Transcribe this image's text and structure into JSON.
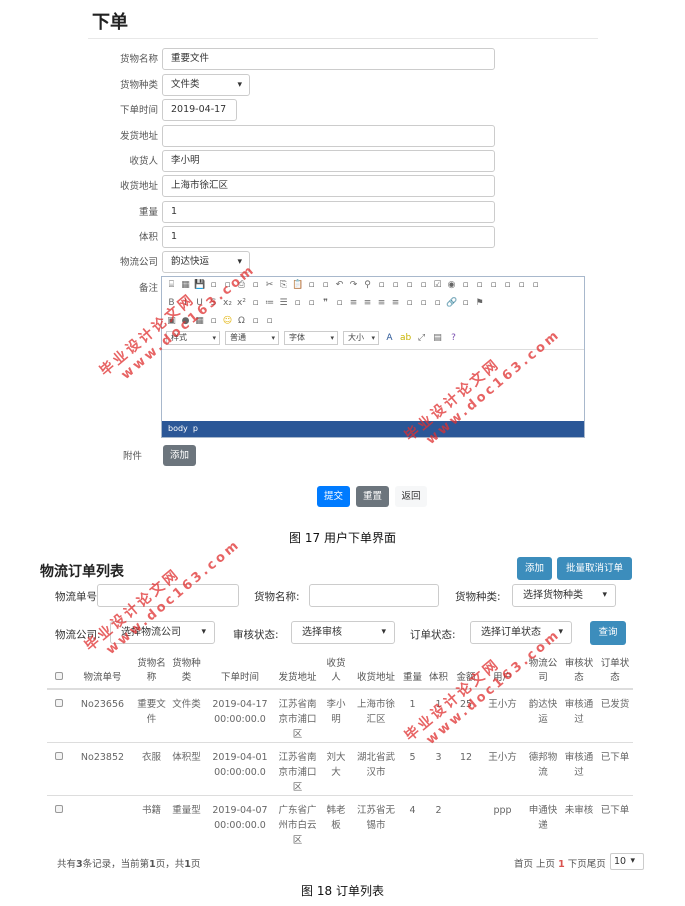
{
  "order_form": {
    "title": "下单",
    "fields": [
      {
        "label": "货物名称",
        "value": "重要文件",
        "type": "text"
      },
      {
        "label": "货物种类",
        "value": "文件类",
        "type": "select"
      },
      {
        "label": "下单时间",
        "value": "2019-04-17",
        "type": "date"
      },
      {
        "label": "发货地址",
        "value": "",
        "type": "text"
      },
      {
        "label": "收货人",
        "value": "李小明",
        "type": "text"
      },
      {
        "label": "收货地址",
        "value": "上海市徐汇区",
        "type": "text"
      },
      {
        "label": "重量",
        "value": "1",
        "type": "text"
      },
      {
        "label": "体积",
        "value": "1",
        "type": "text"
      },
      {
        "label": "物流公司",
        "value": "韵达快运",
        "type": "select"
      }
    ],
    "remark_label": "备注",
    "editor": {
      "toolbar_rows": [
        [
          "source",
          "preview",
          "save",
          "new-page",
          "print-preview",
          "print",
          "templates",
          "cut",
          "copy",
          "paste",
          "paste-text",
          "paste-word",
          "undo",
          "redo",
          "find",
          "replace",
          "select-all",
          "spellcheck",
          "form",
          "checkbox",
          "radio",
          "textfield",
          "textarea",
          "select",
          "button",
          "image-button",
          "hidden-field"
        ],
        [
          "bold",
          "italic",
          "underline",
          "strike",
          "subscript",
          "superscript",
          "remove-format",
          "numbered-list",
          "bulleted-list",
          "outdent",
          "indent",
          "blockquote",
          "div",
          "align-left",
          "align-center",
          "align-right",
          "justify",
          "ltr",
          "rtl",
          "language",
          "link",
          "unlink",
          "anchor"
        ],
        [
          "image",
          "flash",
          "table",
          "horizontal-rule",
          "smiley",
          "special-char",
          "page-break",
          "iframe"
        ]
      ],
      "dropdowns": [
        "样式",
        "普通",
        "字体",
        "大小"
      ],
      "statusbar": "body  p"
    },
    "attachment_label": "附件",
    "attachment_button": "添加",
    "submit": "提交",
    "reset": "重置",
    "back": "返回",
    "colors": {
      "primary": "#007bff",
      "secondary": "#6c757d",
      "editor_bar": "#2b5797"
    }
  },
  "caption1": "图 17 用户下单界面",
  "order_list": {
    "title": "物流订单列表",
    "add_button": "添加",
    "batch_cancel_button": "批量取消订单",
    "filters": {
      "order_no_label": "物流单号:",
      "order_no_value": "",
      "goods_name_label": "货物名称:",
      "goods_name_value": "",
      "goods_type_label": "货物种类:",
      "goods_type_value": "选择货物种类",
      "company_label": "物流公司:",
      "company_value": "选择物流公司",
      "audit_label": "审核状态:",
      "audit_value": "选择审核",
      "status_label": "订单状态:",
      "status_value": "选择订单状态",
      "query_button": "查询"
    },
    "columns": [
      "物流单号",
      "货物名称",
      "货物种类",
      "下单时间",
      "发货地址",
      "收货人",
      "收货地址",
      "重量",
      "体积",
      "金额",
      "用户",
      "物流公司",
      "审核状态",
      "订单状态"
    ],
    "rows": [
      [
        "No23656",
        "重要文件",
        "文件类",
        "2019-04-17 00:00:00.0",
        "江苏省南京市浦口区",
        "李小明",
        "上海市徐汇区",
        "1",
        "1",
        "25",
        "王小方",
        "韵达快运",
        "审核通过",
        "已发货"
      ],
      [
        "No23852",
        "衣服",
        "体积型",
        "2019-04-01 00:00:00.0",
        "江苏省南京市浦口区",
        "刘大大",
        "湖北省武汉市",
        "5",
        "3",
        "12",
        "王小方",
        "德邦物流",
        "审核通过",
        "已下单"
      ],
      [
        "",
        "书籍",
        "重量型",
        "2019-04-07 00:00:00.0",
        "广东省广州市白云区",
        "韩老板",
        "江苏省无锡市",
        "4",
        "2",
        "",
        "ppp",
        "申通快递",
        "未审核",
        "已下单"
      ]
    ],
    "footer": {
      "prefix": "共有",
      "total": "3",
      "mid": "条记录，当前第",
      "page": "1",
      "mid2": "页，共",
      "pages": "1",
      "suffix": "页"
    },
    "pager": {
      "first": "首页",
      "prev": "上页",
      "current": "1",
      "next": "下页",
      "last": "尾页",
      "page_size": "10"
    },
    "colors": {
      "button": "#3c8dbc",
      "current_page": "#d9534f"
    }
  },
  "caption2": "图 18 订单列表",
  "watermark": {
    "line1": "毕业设计论文网",
    "line2": "www.doc163.com"
  }
}
